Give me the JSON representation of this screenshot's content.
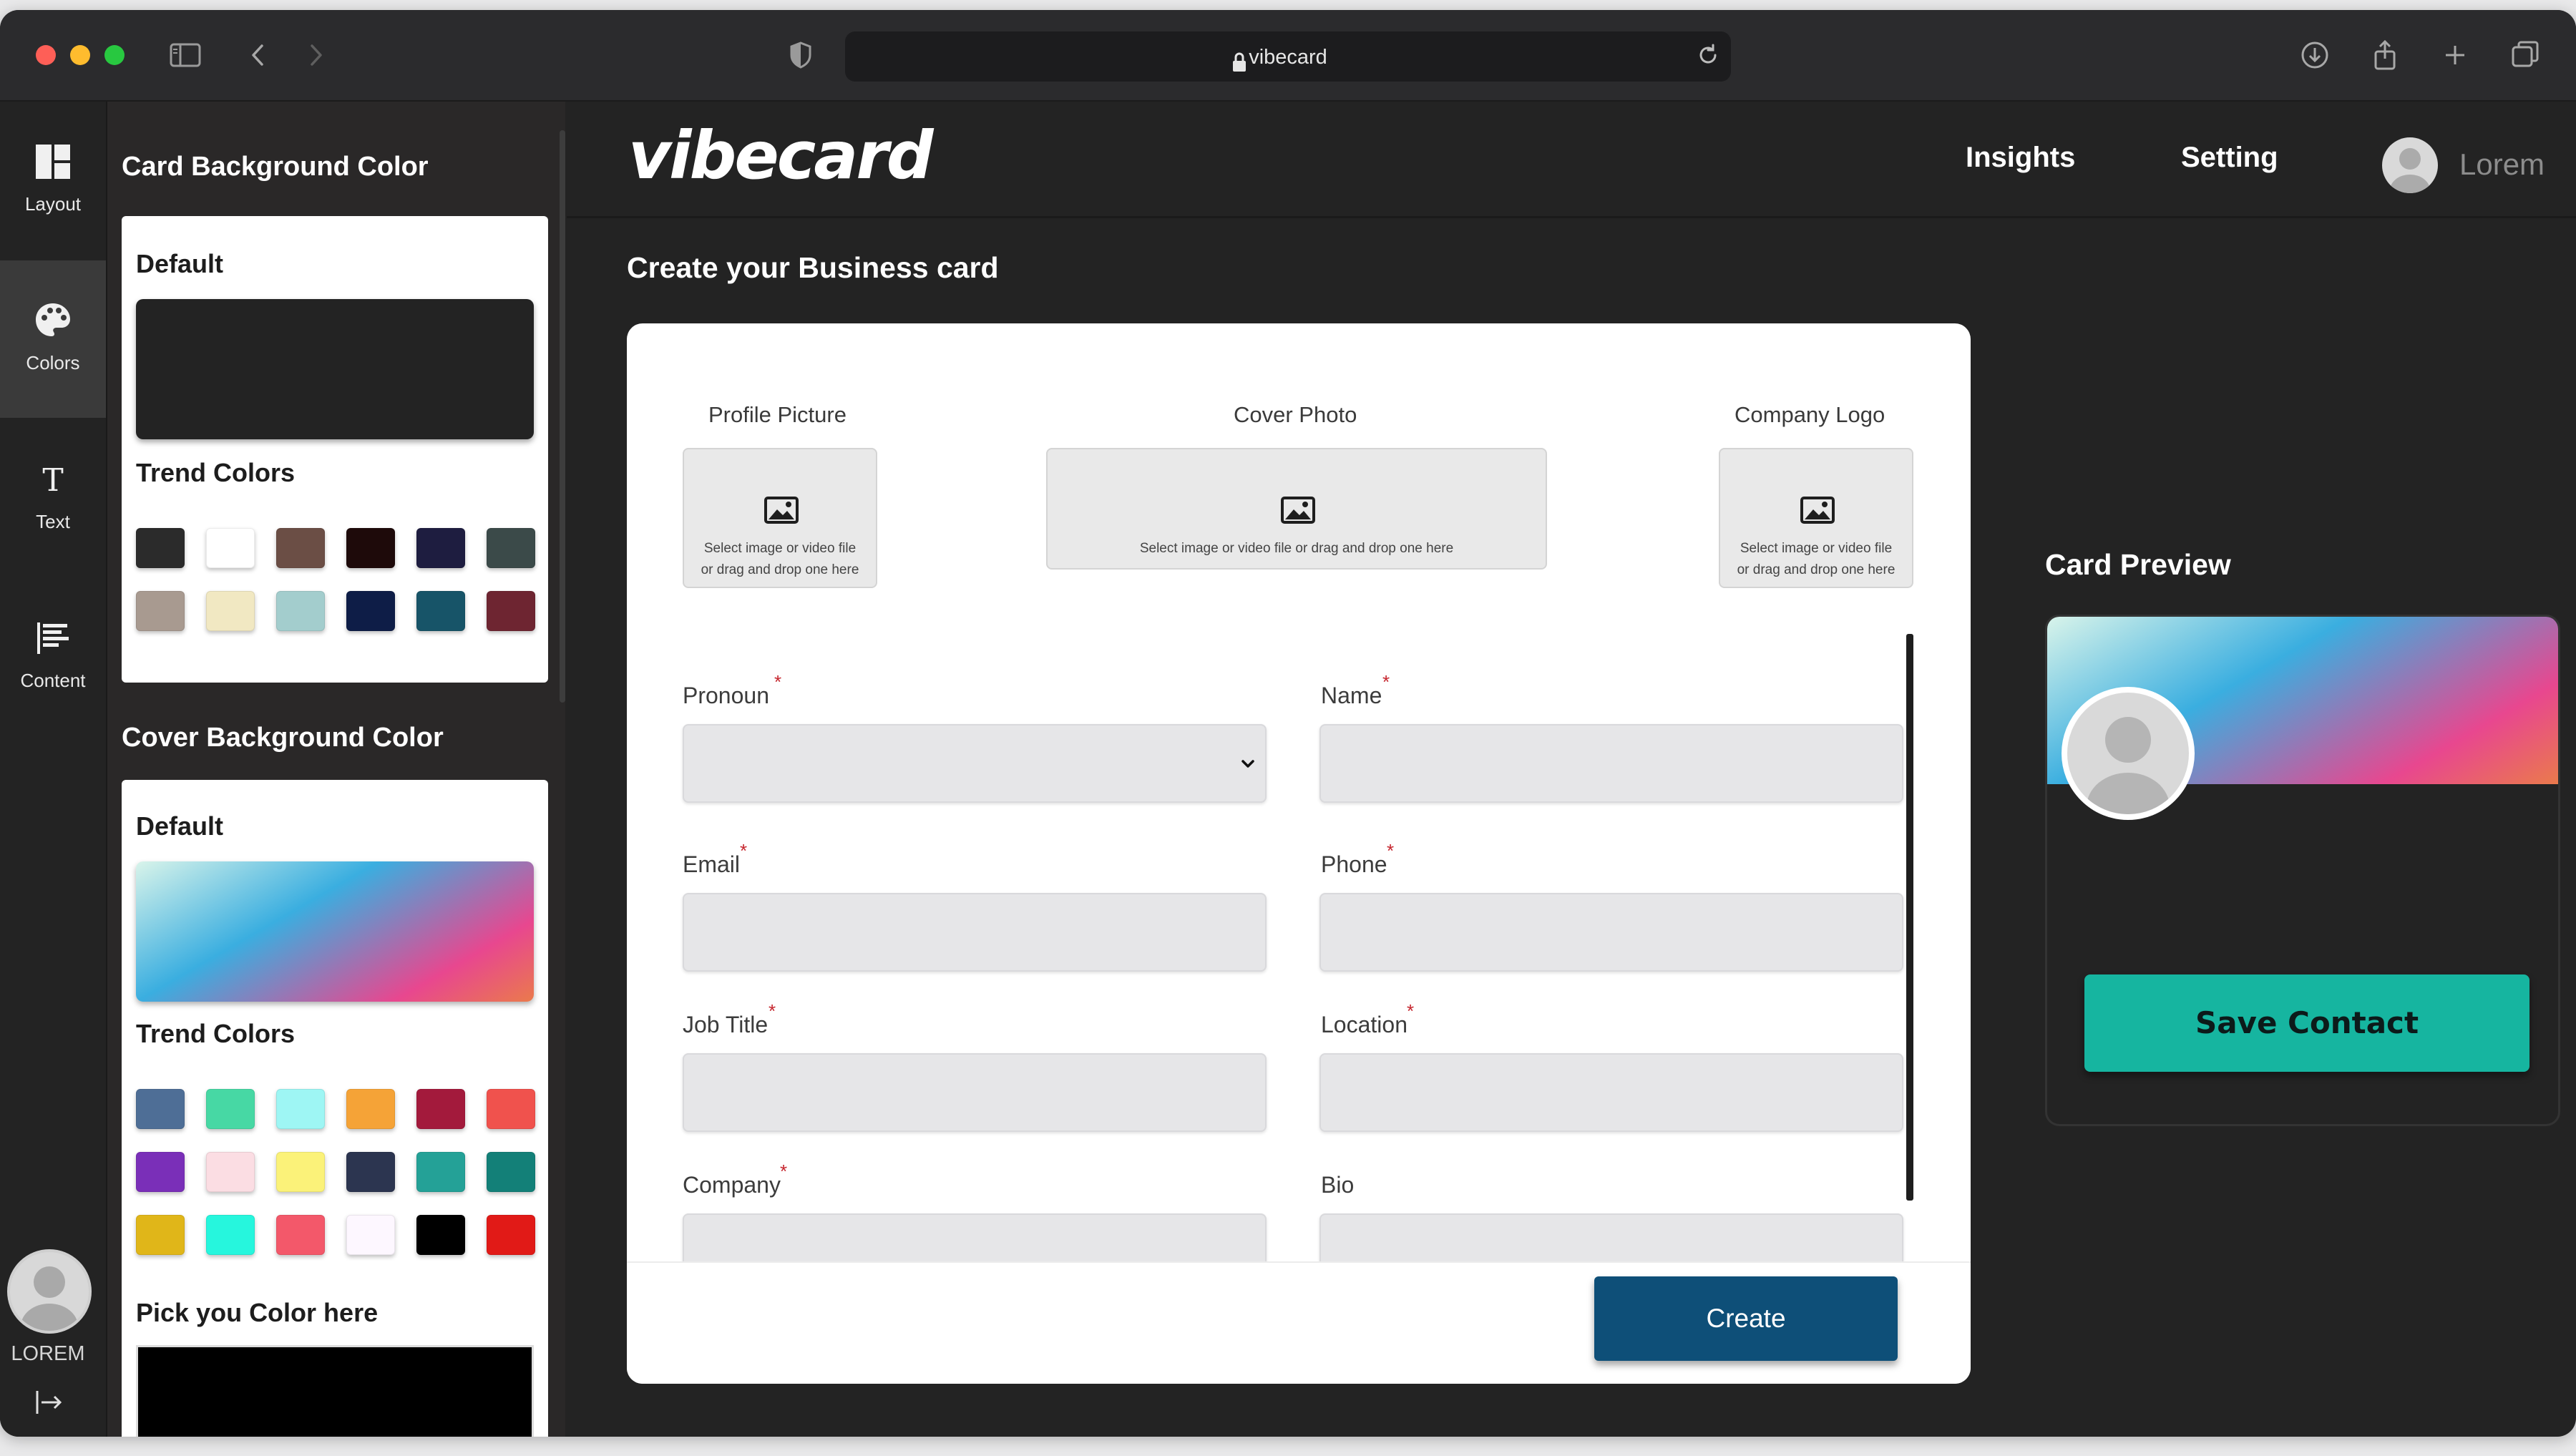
{
  "browser": {
    "url": "vibecard"
  },
  "rail": {
    "items": [
      {
        "label": "Layout",
        "icon": "layout-icon"
      },
      {
        "label": "Colors",
        "icon": "palette-icon",
        "active": true
      },
      {
        "label": "Text",
        "icon": "text-icon"
      },
      {
        "label": "Content",
        "icon": "content-icon"
      }
    ],
    "user_name": "LOREM"
  },
  "panel": {
    "card_bg": {
      "title": "Card Background Color",
      "default_label": "Default",
      "default_color": "#232323",
      "trend_label": "Trend Colors",
      "swatches": [
        "#2b2b2b",
        "#ffffff",
        "#6b4e45",
        "#1e0a0a",
        "#1e1d40",
        "#3b4a49",
        "#a89a90",
        "#f1e8c2",
        "#a3cdcd",
        "#0e1d47",
        "#175468",
        "#6e2531"
      ]
    },
    "cover_bg": {
      "title": "Cover Background Color",
      "default_label": "Default",
      "gradient": [
        "#d9f4ea",
        "#3aaee0",
        "#e8478f",
        "#ea7a4c"
      ],
      "trend_label": "Trend Colors",
      "swatches": [
        "#4e6e96",
        "#47d8a4",
        "#9ef6f4",
        "#f5a337",
        "#a31a3c",
        "#f0524d",
        "#7a2fb8",
        "#fbdde3",
        "#fbf279",
        "#2c3550",
        "#24a197",
        "#138078",
        "#e0b619",
        "#26f6dd",
        "#f3586a",
        "#fdf7ff",
        "#000000",
        "#e11a17"
      ]
    },
    "pick_label": "Pick you Color here",
    "picked_color": "#000000"
  },
  "header": {
    "logo": "vibecard",
    "nav": [
      "Insights",
      "Setting"
    ],
    "user_name": "Lorem"
  },
  "page": {
    "title": "Create your Business card"
  },
  "form": {
    "uploads": [
      {
        "label": "Profile Picture",
        "hint": [
          "Select image or video file",
          "or drag and drop one here"
        ]
      },
      {
        "label": "Cover Photo",
        "hint": [
          "Select image or video file or drag and drop one here"
        ]
      },
      {
        "label": "Company Logo",
        "hint": [
          "Select image or video file",
          "or drag and drop one here"
        ]
      }
    ],
    "fields": {
      "pronoun": {
        "label": "Pronoun",
        "required": "*",
        "value": ""
      },
      "name": {
        "label": "Name",
        "required": "*",
        "value": ""
      },
      "email": {
        "label": "Email",
        "required": "*",
        "value": ""
      },
      "phone": {
        "label": "Phone",
        "required": "*",
        "value": ""
      },
      "job_title": {
        "label": "Job Title",
        "required": "*",
        "value": ""
      },
      "location": {
        "label": "Location",
        "required": "*",
        "value": ""
      },
      "company": {
        "label": "Company",
        "required": "*",
        "value": ""
      },
      "bio": {
        "label": "Bio",
        "value": ""
      }
    },
    "create_label": "Create"
  },
  "preview": {
    "title": "Card Preview",
    "save_label": "Save Contact"
  },
  "colors": {
    "accent_teal": "#16b5a0",
    "create_blue": "#0e4f78",
    "app_bg": "#232323"
  }
}
